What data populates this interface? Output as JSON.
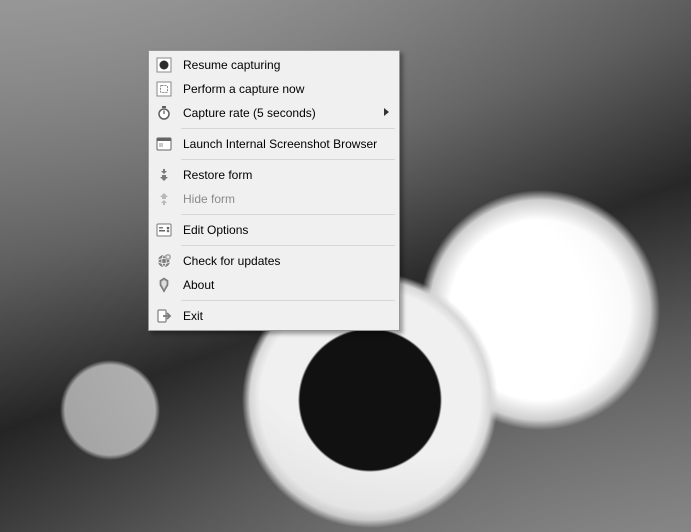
{
  "menu": {
    "items": [
      {
        "label": "Resume capturing",
        "icon": "record-icon",
        "enabled": true,
        "submenu": false
      },
      {
        "label": "Perform a capture now",
        "icon": "capture-icon",
        "enabled": true,
        "submenu": false
      },
      {
        "label": "Capture rate (5 seconds)",
        "icon": "stopwatch-icon",
        "enabled": true,
        "submenu": true
      },
      "sep",
      {
        "label": "Launch Internal Screenshot Browser",
        "icon": "browser-icon",
        "enabled": true,
        "submenu": false
      },
      "sep",
      {
        "label": "Restore form",
        "icon": "restore-icon",
        "enabled": true,
        "submenu": false
      },
      {
        "label": "Hide form",
        "icon": "hide-icon",
        "enabled": false,
        "submenu": false
      },
      "sep",
      {
        "label": "Edit Options",
        "icon": "options-icon",
        "enabled": true,
        "submenu": false
      },
      "sep",
      {
        "label": "Check for updates",
        "icon": "updates-icon",
        "enabled": true,
        "submenu": false
      },
      {
        "label": "About",
        "icon": "about-icon",
        "enabled": true,
        "submenu": false
      },
      "sep",
      {
        "label": "Exit",
        "icon": "exit-icon",
        "enabled": true,
        "submenu": false
      }
    ]
  }
}
